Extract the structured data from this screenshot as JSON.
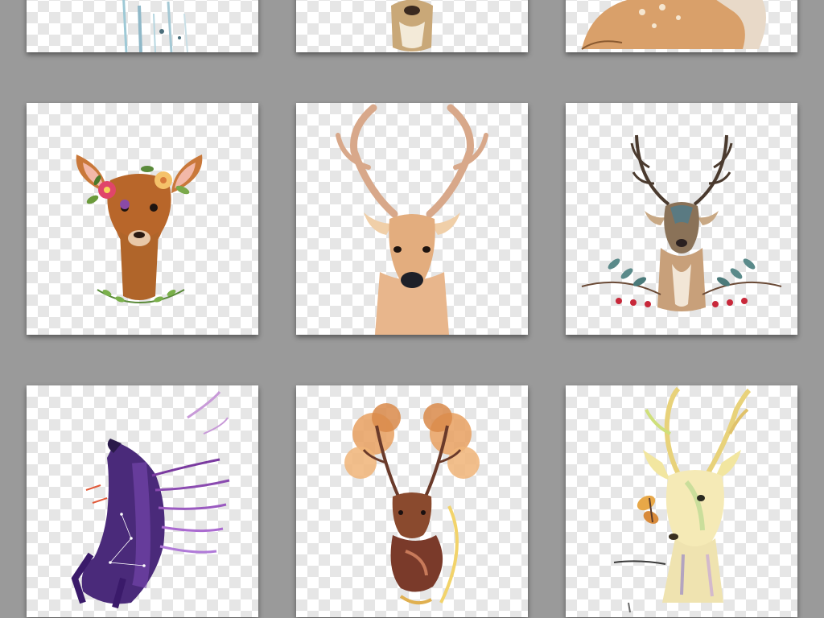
{
  "gallery": {
    "items": [
      {
        "subject": "watercolor-drip-fragment",
        "row": "partial-top"
      },
      {
        "subject": "deer-chin-fragment",
        "row": "partial-top"
      },
      {
        "subject": "lying-fawn-fragment",
        "row": "partial-top"
      },
      {
        "subject": "fawn-with-flower-crown",
        "row": "middle"
      },
      {
        "subject": "watercolor-stag-head",
        "row": "middle"
      },
      {
        "subject": "stag-with-berry-wreath",
        "row": "middle"
      },
      {
        "subject": "galaxy-purple-deer",
        "row": "bottom"
      },
      {
        "subject": "autumn-tree-antler-deer",
        "row": "bottom"
      },
      {
        "subject": "pastel-deer-with-butterfly",
        "row": "bottom"
      }
    ]
  },
  "colors": {
    "page_background": "#9a9a9a",
    "checker_light": "#ffffff",
    "checker_dark": "#e6e6e6",
    "deer_tan": "#d9a06a",
    "deer_brown": "#b0652a",
    "galaxy_purple": "#5a2d8a",
    "antler_autumn": "#d98a4a",
    "pastel_yellow": "#e8d27a"
  }
}
